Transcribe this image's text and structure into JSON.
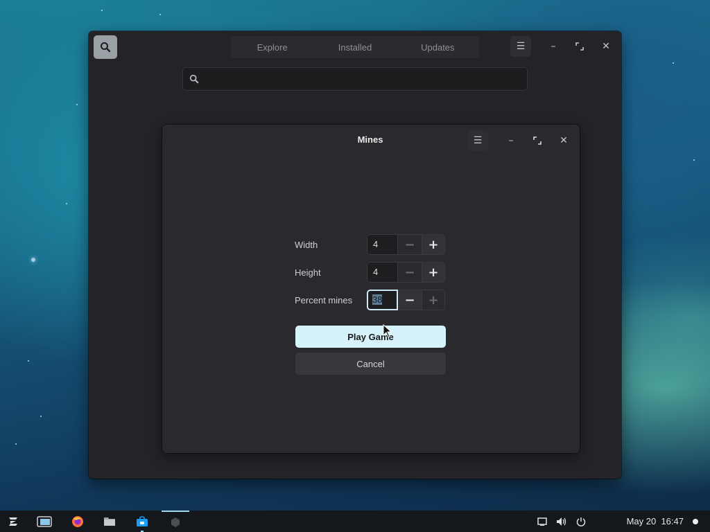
{
  "software_window": {
    "tabs": [
      "Explore",
      "Installed",
      "Updates"
    ],
    "search_placeholder": ""
  },
  "mines_dialog": {
    "title": "Mines",
    "rows": [
      {
        "label": "Width",
        "value": "4"
      },
      {
        "label": "Height",
        "value": "4"
      },
      {
        "label": "Percent mines",
        "value": "38"
      }
    ],
    "play_label": "Play Game",
    "cancel_label": "Cancel"
  },
  "taskbar": {
    "date": "May 20",
    "time": "16:47"
  },
  "colors": {
    "accent": "#d6f2fb",
    "window_bg": "#242428",
    "dialog_bg": "#2a2a2e",
    "taskbar_bg": "#14181c"
  }
}
